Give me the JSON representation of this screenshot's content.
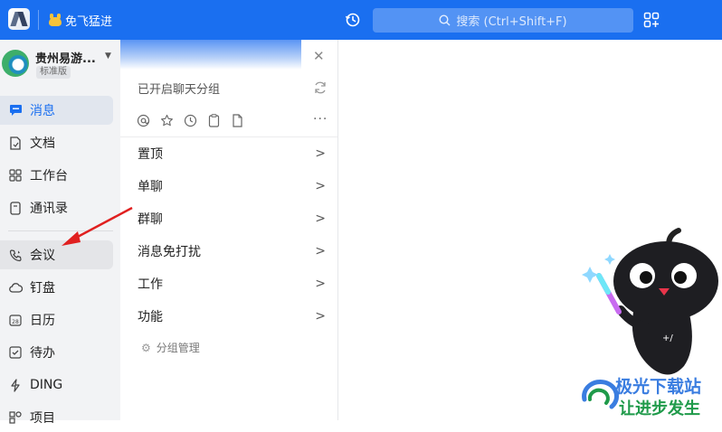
{
  "topbar": {
    "org_chip": "免飞猛进",
    "search_placeholder": "搜索 (Ctrl+Shift+F)"
  },
  "sidebar": {
    "org_name": "贵州易游...",
    "org_tag": "标准版",
    "items": [
      {
        "label": "消息",
        "icon": "message-icon"
      },
      {
        "label": "文档",
        "icon": "document-icon"
      },
      {
        "label": "工作台",
        "icon": "workbench-icon"
      },
      {
        "label": "通讯录",
        "icon": "contacts-icon"
      },
      {
        "label": "会议",
        "icon": "meeting-icon"
      },
      {
        "label": "钉盘",
        "icon": "cloud-icon"
      },
      {
        "label": "日历",
        "icon": "calendar-icon"
      },
      {
        "label": "待办",
        "icon": "todo-icon"
      },
      {
        "label": "DING",
        "icon": "ding-icon"
      },
      {
        "label": "项目",
        "icon": "project-icon"
      }
    ]
  },
  "panel": {
    "grouping_text": "已开启聊天分组",
    "rows": [
      {
        "label": "置顶"
      },
      {
        "label": "单聊"
      },
      {
        "label": "群聊"
      },
      {
        "label": "消息免打扰"
      },
      {
        "label": "工作"
      },
      {
        "label": "功能"
      }
    ],
    "manage_label": "分组管理"
  },
  "watermark": {
    "line1": "极光下载站",
    "line2": "让进步发生"
  },
  "colors": {
    "accent": "#1a6ff0",
    "annotation": "#e02020"
  }
}
